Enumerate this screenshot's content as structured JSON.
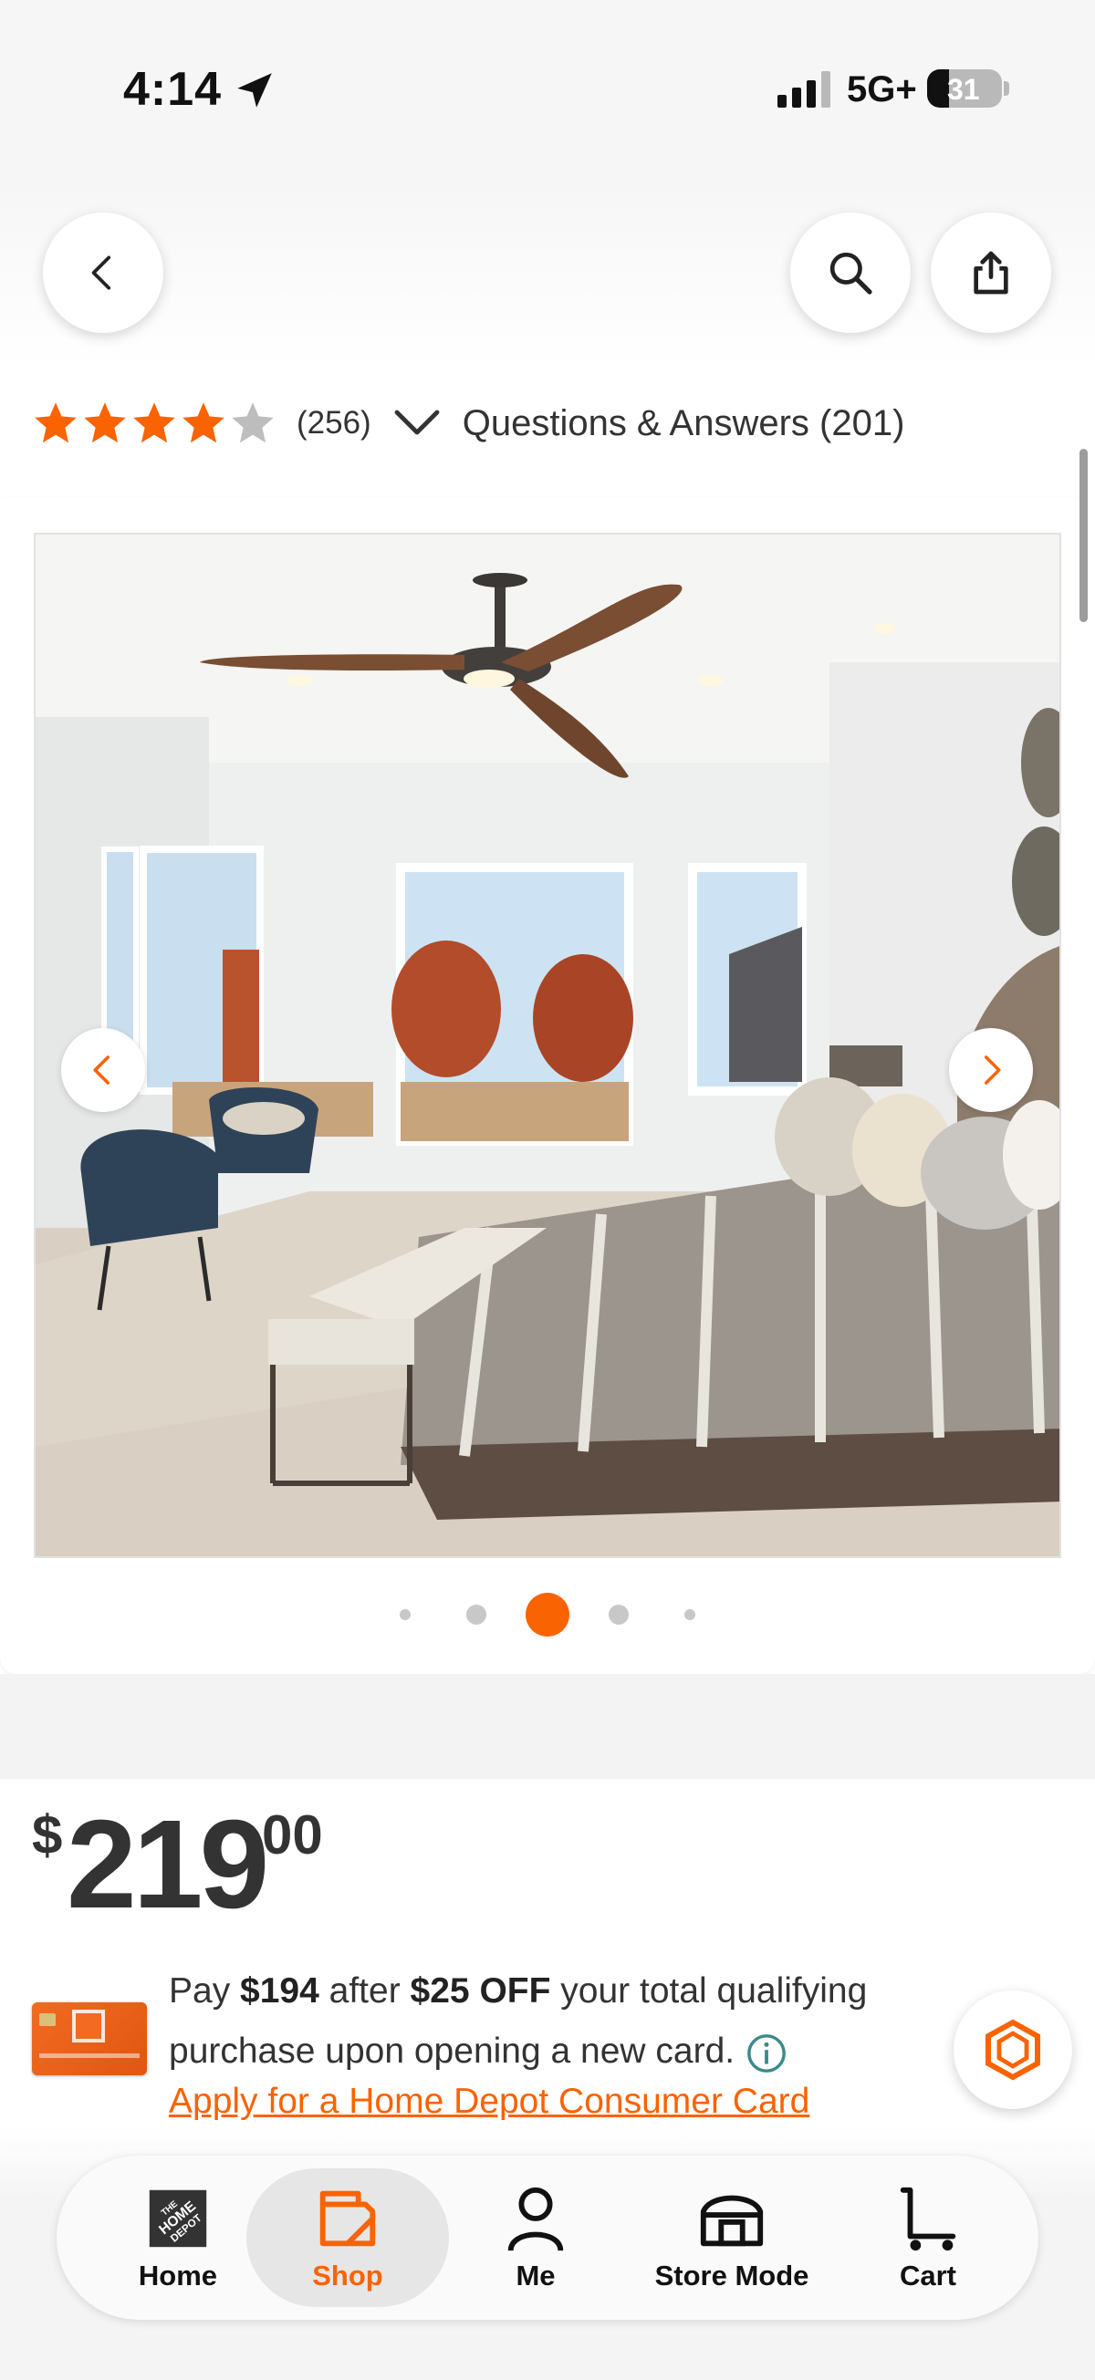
{
  "status_bar": {
    "time": "4:14",
    "network": "5G+",
    "battery": "31"
  },
  "rating": {
    "stars": 4,
    "max_stars": 5,
    "review_count": "(256)",
    "qa_label": "Questions & Answers (201)"
  },
  "carousel": {
    "active_index": 2,
    "dot_count": 5
  },
  "price": {
    "currency": "$",
    "whole": "219",
    "cents": "00"
  },
  "promo": {
    "pay_prefix": "Pay",
    "pay_amount": "$194",
    "after": "after",
    "discount": "$25 OFF",
    "rest": "your total qualifying purchase upon opening a new card.",
    "apply_link": "Apply for a Home Depot Consumer Card"
  },
  "bottom_nav": {
    "items": [
      {
        "label": "Home",
        "icon": "home-depot-logo-icon"
      },
      {
        "label": "Shop",
        "icon": "shop-tag-icon"
      },
      {
        "label": "Me",
        "icon": "person-icon"
      },
      {
        "label": "Store Mode",
        "icon": "store-icon"
      },
      {
        "label": "Cart",
        "icon": "cart-icon"
      }
    ],
    "active": "Shop"
  },
  "colors": {
    "accent": "#f96302",
    "star": "#f96302",
    "star_empty": "#bdbdbd",
    "info": "#3a8a8a"
  }
}
